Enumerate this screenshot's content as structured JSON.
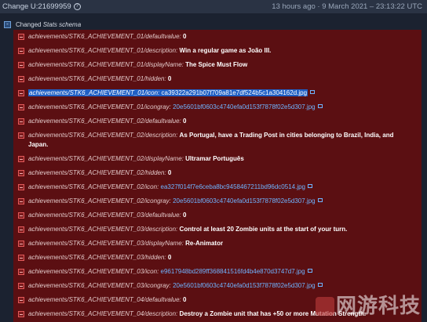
{
  "header": {
    "change_label": "Change U:21699959",
    "help_glyph": "?",
    "timestamp": "13 hours ago · 9 March 2021 – 23:13:22 UTC"
  },
  "schema": {
    "prefix": "Changed ",
    "name": "Stats schema",
    "icon_glyph": "-"
  },
  "rows": [
    {
      "key": "achievements/STK6_ACHIEVEMENT_01/defaultvalue:",
      "value": "0",
      "type": "value"
    },
    {
      "key": "achievements/STK6_ACHIEVEMENT_01/description:",
      "value": "Win a regular game as João III.",
      "type": "value"
    },
    {
      "key": "achievements/STK6_ACHIEVEMENT_01/displayName:",
      "value": "The Spice Must Flow",
      "type": "value"
    },
    {
      "key": "achievements/STK6_ACHIEVEMENT_01/hidden:",
      "value": "0",
      "type": "value"
    },
    {
      "key": "achievements/STK6_ACHIEVEMENT_01/icon:",
      "value": "ca39322a291b07f709a81e7df524b5c1a304162d.jpg",
      "type": "selected"
    },
    {
      "key": "achievements/STK6_ACHIEVEMENT_01/icongray:",
      "value": "20e5601bf0603c4740efa0d153f7878f02e5d307.jpg",
      "type": "link"
    },
    {
      "key": "achievements/STK6_ACHIEVEMENT_02/defaultvalue:",
      "value": "0",
      "type": "value"
    },
    {
      "key": "achievements/STK6_ACHIEVEMENT_02/description:",
      "value": "As Portugal, have a Trading Post in cities belonging to Brazil, India, and",
      "value2": "Japan.",
      "type": "double"
    },
    {
      "key": "achievements/STK6_ACHIEVEMENT_02/displayName:",
      "value": "Ultramar Português",
      "type": "value"
    },
    {
      "key": "achievements/STK6_ACHIEVEMENT_02/hidden:",
      "value": "0",
      "type": "value"
    },
    {
      "key": "achievements/STK6_ACHIEVEMENT_02/icon:",
      "value": "ea327f014f7e6ceba8bc9458467211bd96dc0514.jpg",
      "type": "link"
    },
    {
      "key": "achievements/STK6_ACHIEVEMENT_02/icongray:",
      "value": "20e5601bf0603c4740efa0d153f7878f02e5d307.jpg",
      "type": "link"
    },
    {
      "key": "achievements/STK6_ACHIEVEMENT_03/defaultvalue:",
      "value": "0",
      "type": "value"
    },
    {
      "key": "achievements/STK6_ACHIEVEMENT_03/description:",
      "value": "Control at least 20 Zombie units at the start of your turn.",
      "type": "value"
    },
    {
      "key": "achievements/STK6_ACHIEVEMENT_03/displayName:",
      "value": "Re-Animator",
      "type": "value"
    },
    {
      "key": "achievements/STK6_ACHIEVEMENT_03/hidden:",
      "value": "0",
      "type": "value"
    },
    {
      "key": "achievements/STK6_ACHIEVEMENT_03/icon:",
      "value": "e9617948bd289ff368841516fd4b4e870d3747d7.jpg",
      "type": "link"
    },
    {
      "key": "achievements/STK6_ACHIEVEMENT_03/icongray:",
      "value": "20e5601bf0603c4740efa0d153f7878f02e5d307.jpg",
      "type": "link"
    },
    {
      "key": "achievements/STK6_ACHIEVEMENT_04/defaultvalue:",
      "value": "0",
      "type": "value"
    },
    {
      "key": "achievements/STK6_ACHIEVEMENT_04/description:",
      "value": "Destroy a Zombie unit that has +50 or more Mutation Strength.",
      "type": "value"
    }
  ],
  "watermark": {
    "text": "网游科技"
  },
  "colors": {
    "background": "#1b2230",
    "panel": "#5b0f12",
    "link": "#6fb4ff",
    "selection": "#1f5fc4"
  }
}
